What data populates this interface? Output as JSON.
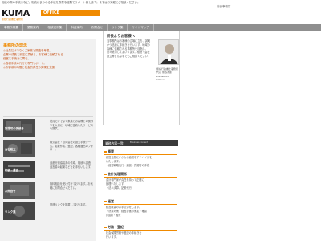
{
  "header": {
    "intro": "相続の際の手続きなど、相続にまつわる手続を専業な経験でサポート致します。まずはお気軽にご相談ください。",
    "logo_text": "KUMA",
    "logo_accent": "OFFICE",
    "logo_sub": "熊谷行政書士事務所",
    "firm_name": "熊谷事務所",
    "colors": {
      "accent": "#f08a00",
      "nav_bg": "#8f8f8f"
    }
  },
  "nav": {
    "items": [
      {
        "label": "事務所概要"
      },
      {
        "label": "業務案内"
      },
      {
        "label": "相談実例集"
      },
      {
        "label": "料金案内"
      },
      {
        "label": "お問合せ"
      },
      {
        "label": "リンク集"
      },
      {
        "label": "サイトマップ"
      }
    ]
  },
  "philosophy": {
    "title": "事務所の理念",
    "lines": [
      "◎社員だけでなくご家族と関連を考慮。",
      "企業の成長と安定に貢献し、お客様に信頼される",
      "経営と手続きに寄与。",
      "◎各種手続の代行と専門サポート。",
      "◎お客様の時間と社会的責任の実現を支援"
    ]
  },
  "features": [
    {
      "label": "許認可の手続き",
      "desc": "社員だけでなく家族とお客様との関わりを大切に、地域に密着したサービスを提供。"
    },
    {
      "label": "会社設立",
      "desc": "株式会社・合同会社の設立手続き一式。定款作成、登記、各種届出のフォロー。"
    },
    {
      "label": "相続・遺言",
      "desc": "遺産分割協議書の作成、相続人調査、遺言書の起案などをお手伝いします。"
    },
    {
      "label": "お問合せ",
      "desc": "無料相談を受け付けております。お気軽にお問合せください。"
    },
    {
      "label": "リンク集",
      "desc": "関連リンクを掲載しております。"
    }
  ],
  "greeting": {
    "title": "所長よりお客様へ",
    "text": "当事務所はお客様の立場に立ち、誠実かつ迅速に手続きを行います。地域の皆様に信頼される事務所を目指し、日々努力してまいります。相続・会社設立等どんな事でもご相談ください。",
    "meta_lines": [
      "熊谷行政書士事務所",
      "代表 熊谷次郎",
      "kumashiro",
      "katsuro"
    ]
  },
  "business": {
    "title": "業務内容一覧",
    "title_en": "Business content",
    "sections": [
      {
        "head": "概要",
        "lines": [
          "経営全般にかかわる適切なアドバイスを",
          "いたします。",
          "・経営戦略代行・建設・許認可の手続"
        ]
      },
      {
        "head": "会計処理関係",
        "lines": [
          "会計専門家が責任を持って正確に",
          "処理いたします。",
          "・法人決算、記帳代行"
        ]
      },
      {
        "head": "経営",
        "lines": [
          "経営改善のお手伝いをします。",
          "・決算対策・経営計画の策定・確認",
          "(相談)・融資"
        ]
      },
      {
        "head": "労務・登記",
        "lines": [
          "社会保険労務や登記の手続きを",
          "行います。"
        ]
      }
    ]
  }
}
